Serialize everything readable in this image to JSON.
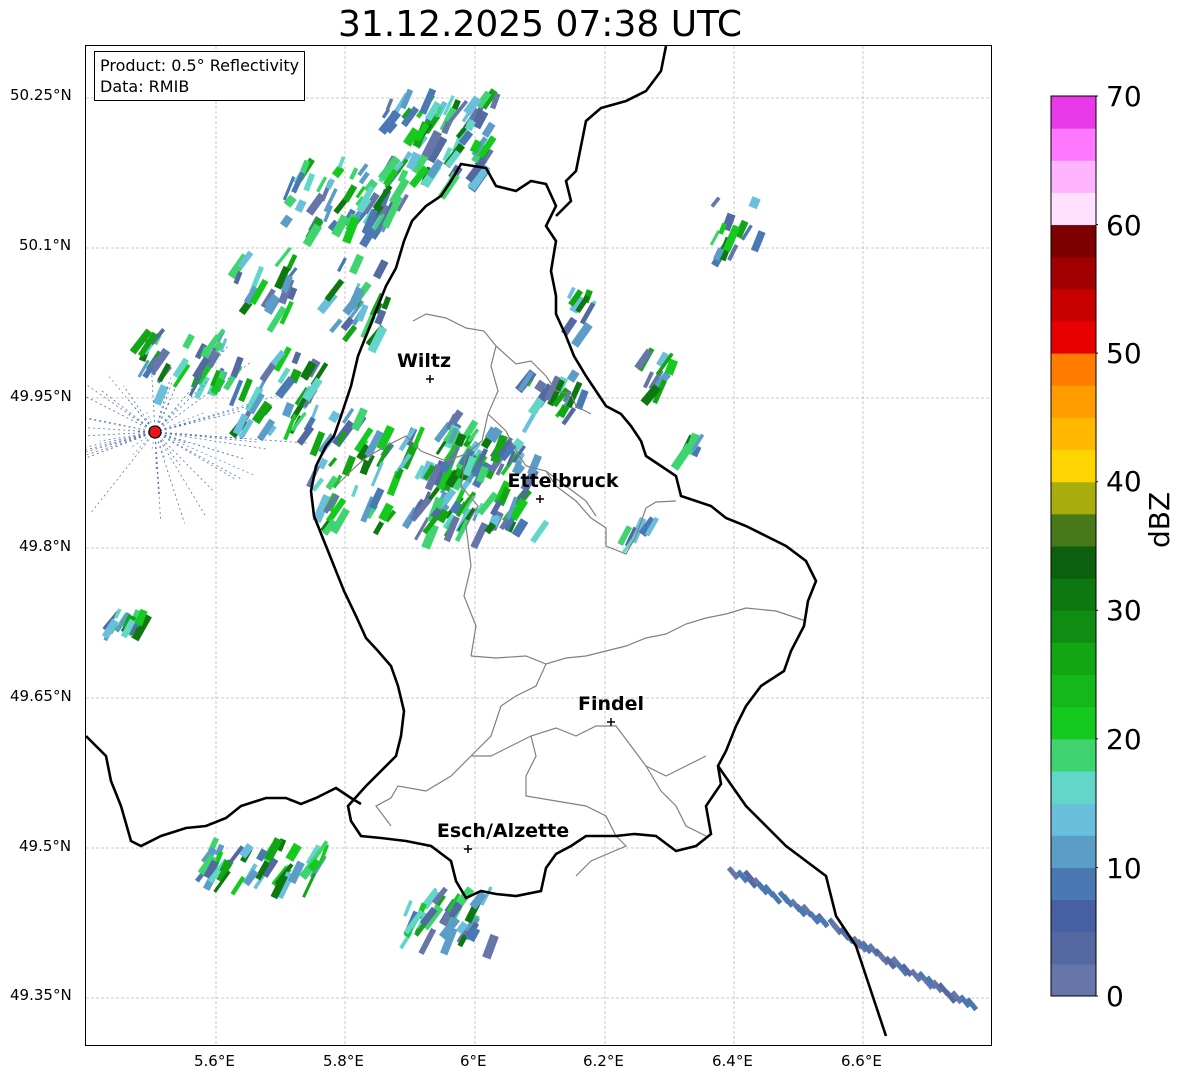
{
  "map": {
    "title": "31.12.2025 07:38 UTC",
    "info": {
      "product": "Product: 0.5° Reflectivity",
      "data": "Data: RMIB"
    },
    "lat_ticks": [
      "50.25°N",
      "50.1°N",
      "49.95°N",
      "49.8°N",
      "49.65°N",
      "49.5°N",
      "49.35°N"
    ],
    "lon_ticks": [
      "5.6°E",
      "5.8°E",
      "6°E",
      "6.2°E",
      "6.4°E",
      "6.6°E"
    ],
    "cities": [
      {
        "name": "Wiltz"
      },
      {
        "name": "Ettelbruck"
      },
      {
        "name": "Findel"
      },
      {
        "name": "Esch/Alzette"
      }
    ],
    "radar_site_color": "#e8141c",
    "colorbar": {
      "label": "dBZ",
      "ticks": [
        "0",
        "10",
        "20",
        "30",
        "40",
        "50",
        "60",
        "70"
      ],
      "colors": [
        "#6776a8",
        "#5469a1",
        "#4660a3",
        "#4a78b3",
        "#5b9dc7",
        "#6ac0dc",
        "#62d6c8",
        "#3fd46f",
        "#16c91e",
        "#14b81a",
        "#12a514",
        "#118c12",
        "#0e7810",
        "#0c5f0c",
        "#48781a",
        "#a8ac0c",
        "#ffd500",
        "#ffb800",
        "#ff9c00",
        "#ff7c00",
        "#e80000",
        "#c80000",
        "#a00000",
        "#7c0000",
        "#ffe0ff",
        "#ffb4ff",
        "#ff78ff",
        "#e838e8"
      ]
    }
  }
}
